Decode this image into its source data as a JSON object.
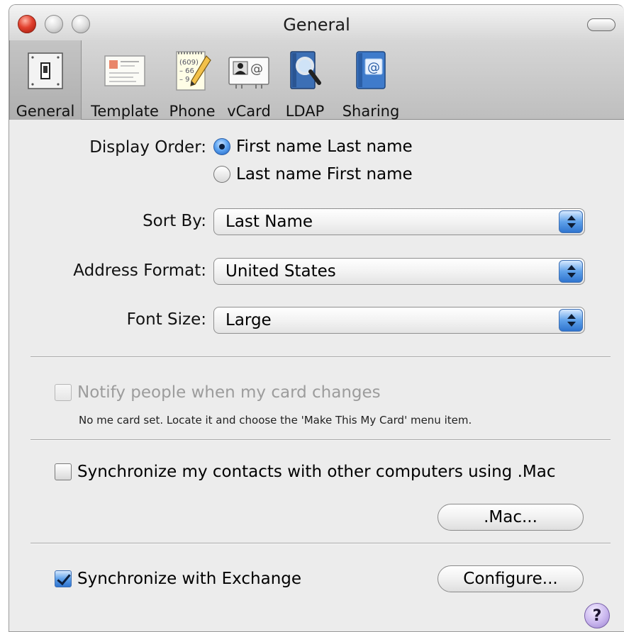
{
  "window": {
    "title": "General"
  },
  "toolbar": {
    "items": [
      {
        "label": "General",
        "icon": "switch-icon",
        "selected": true
      },
      {
        "label": "Template",
        "icon": "card-template-icon"
      },
      {
        "label": "Phone",
        "icon": "phone-notepad-icon"
      },
      {
        "label": "vCard",
        "icon": "vcard-icon"
      },
      {
        "label": "LDAP",
        "icon": "ldap-magnifier-icon"
      },
      {
        "label": "Sharing",
        "icon": "sharing-book-icon"
      }
    ]
  },
  "display_order": {
    "label": "Display Order:",
    "options": [
      "First name Last name",
      "Last name First name"
    ],
    "selected_index": 0
  },
  "sort_by": {
    "label": "Sort By:",
    "value": "Last Name"
  },
  "address_format": {
    "label": "Address Format:",
    "value": "United States"
  },
  "font_size": {
    "label": "Font Size:",
    "value": "Large"
  },
  "notify": {
    "label": "Notify people when my card changes",
    "checked": false,
    "enabled": false,
    "hint": "No me card set. Locate it and choose the 'Make This My Card' menu item."
  },
  "sync_mac": {
    "label": "Synchronize my contacts with other computers using .Mac",
    "checked": false,
    "button_label": ".Mac..."
  },
  "sync_exchange": {
    "label": "Synchronize with Exchange",
    "checked": true,
    "button_label": "Configure..."
  },
  "help": {
    "label": "?"
  },
  "colors": {
    "accent": "#2f74cf",
    "close_button": "#e2412f",
    "help_button": "#c9b6ee",
    "window_bg": "#ececec"
  }
}
